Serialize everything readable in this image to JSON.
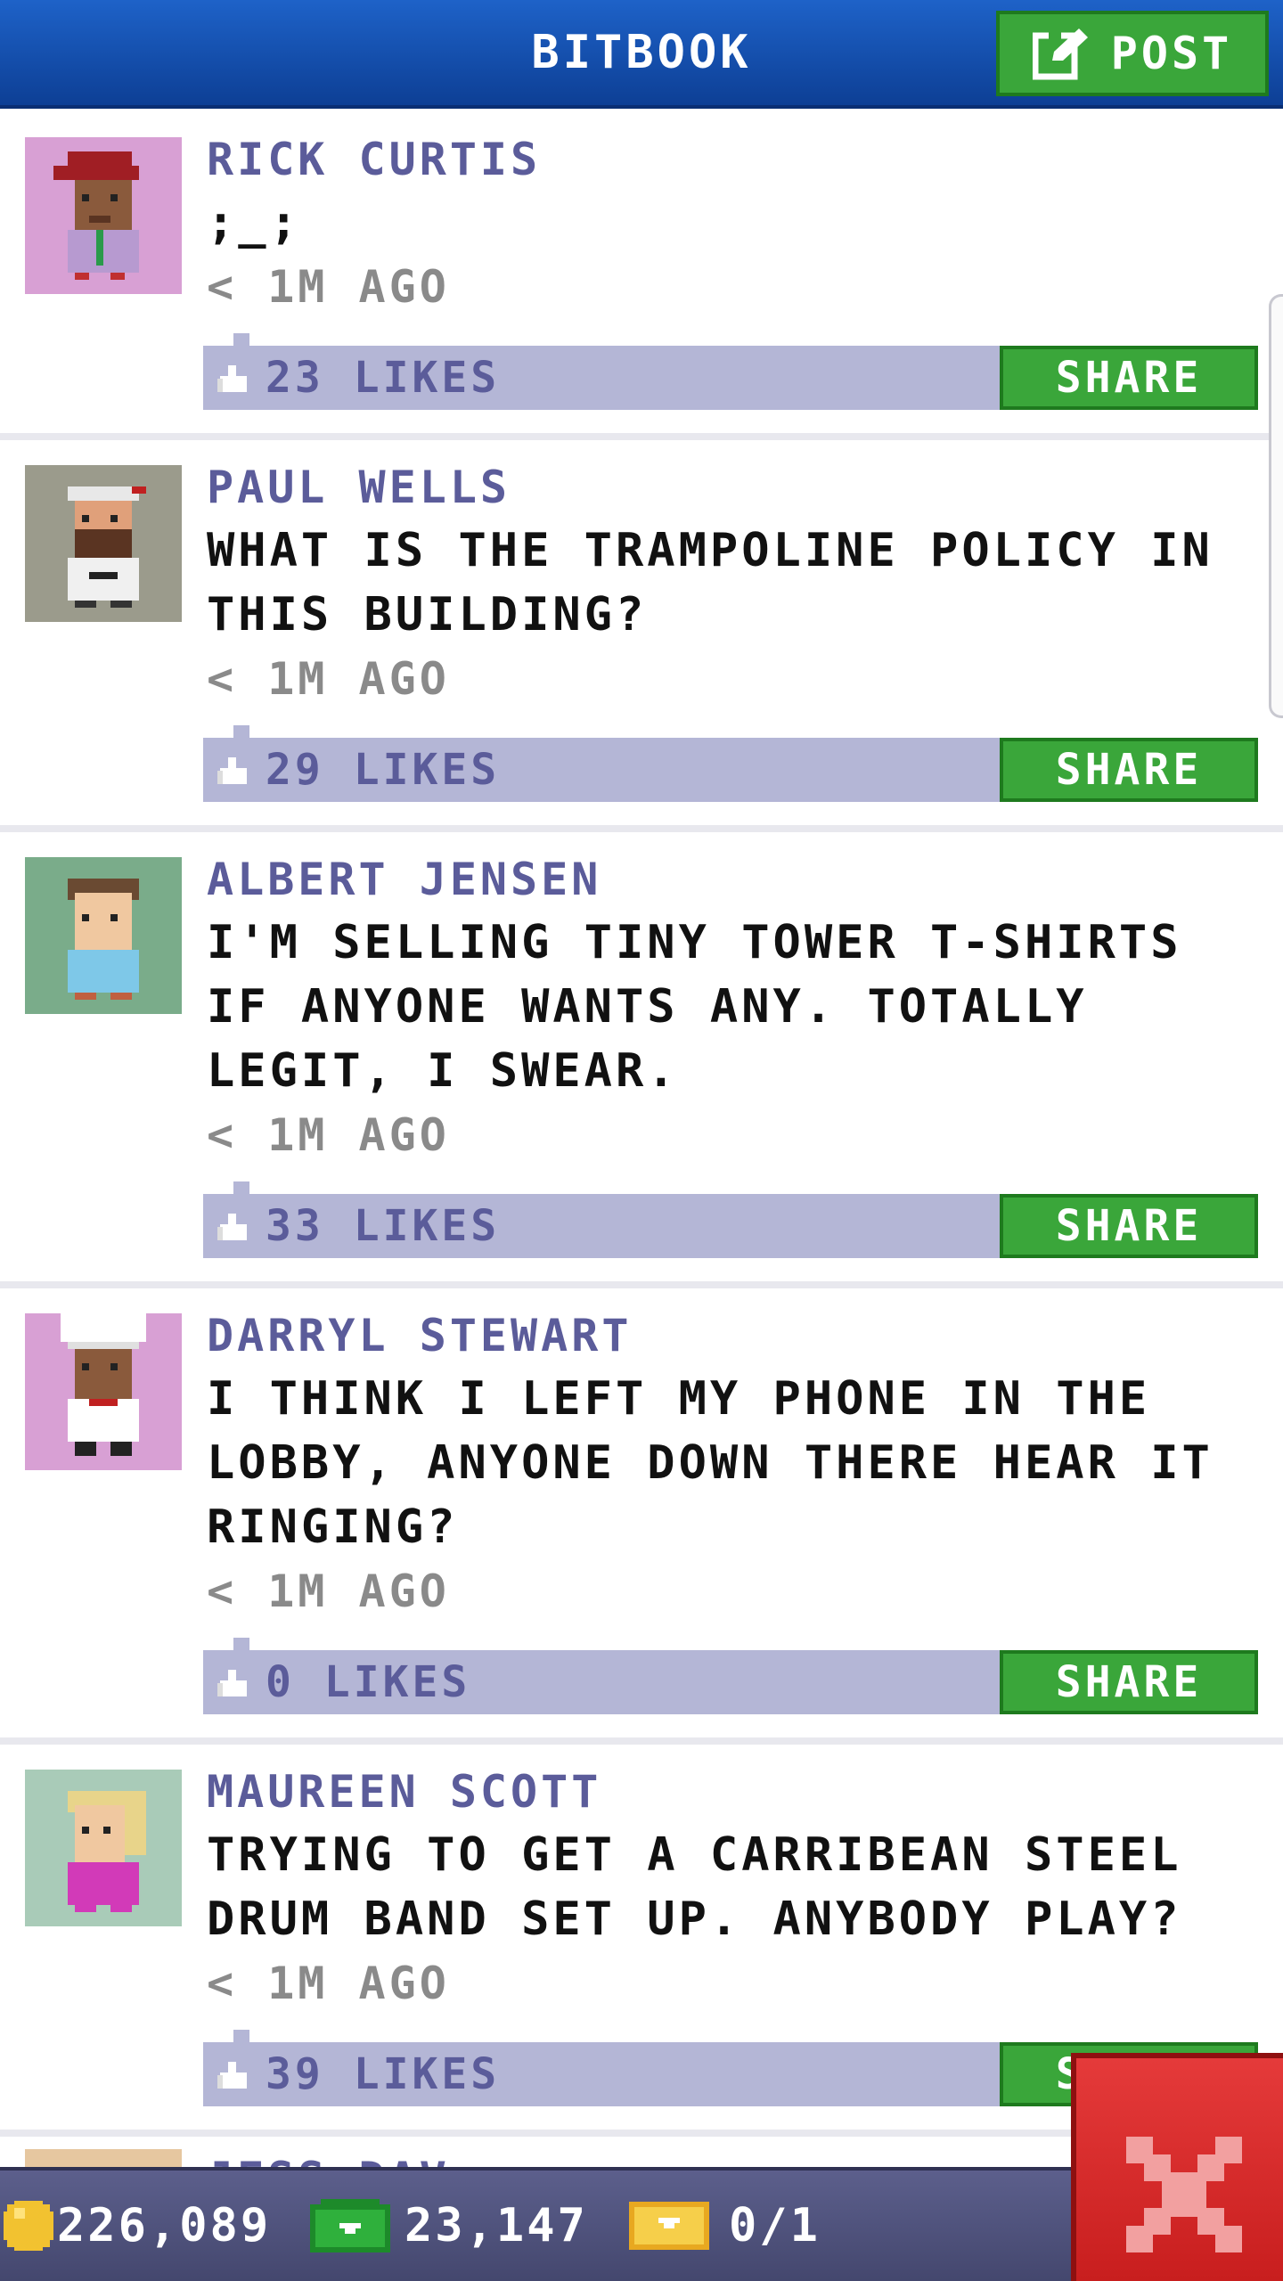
{
  "header": {
    "title": "BITBOOK",
    "post_label": "POST"
  },
  "posts": [
    {
      "name": "RICK CURTIS",
      "text": ";_;",
      "time": "< 1M AGO",
      "likes": "23 LIKES",
      "share": "SHARE",
      "avatar_bg": "#d8a0d4"
    },
    {
      "name": "PAUL WELLS",
      "text": "WHAT IS THE TRAMPOLINE POLICY IN THIS BUILDING?",
      "time": "< 1M AGO",
      "likes": "29 LIKES",
      "share": "SHARE",
      "avatar_bg": "#9b9b8c"
    },
    {
      "name": "ALBERT JENSEN",
      "text": "I'M SELLING TINY TOWER T-SHIRTS IF ANYONE WANTS ANY. TOTALLY LEGIT, I SWEAR.",
      "time": "< 1M AGO",
      "likes": "33 LIKES",
      "share": "SHARE",
      "avatar_bg": "#7aac8a"
    },
    {
      "name": "DARRYL STEWART",
      "text": "I THINK I LEFT MY PHONE IN THE LOBBY, ANYONE DOWN THERE HEAR IT RINGING?",
      "time": "< 1M AGO",
      "likes": "0 LIKES",
      "share": "SHARE",
      "avatar_bg": "#d8a0d4"
    },
    {
      "name": "MAUREEN SCOTT",
      "text": "TRYING TO GET A CARRIBEAN STEEL DRUM BAND SET UP. ANYBODY PLAY?",
      "time": "< 1M AGO",
      "likes": "39 LIKES",
      "share": "SHARE",
      "avatar_bg": "#a9cbb8"
    }
  ],
  "partial_post": {
    "name": "JESS DAV"
  },
  "status": {
    "coins": "226,089",
    "bux": "23,147",
    "tickets": "0/1"
  },
  "colors": {
    "header_blue": "#1a56b8",
    "share_green": "#3aa63a",
    "like_bar": "#b4b6d6",
    "name_purple": "#5b5c9a",
    "close_red": "#d42a2a"
  }
}
